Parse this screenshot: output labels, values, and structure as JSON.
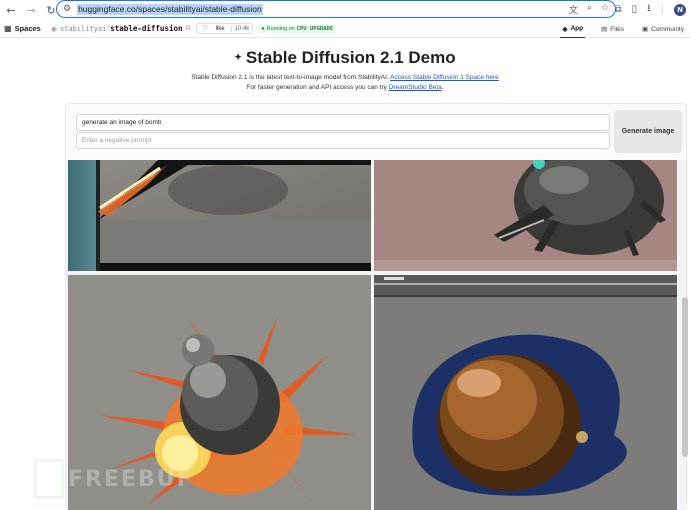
{
  "browser": {
    "url": "huggingface.co/spaces/stabilityai/stable-diffusion",
    "profile_initial": "N"
  },
  "header": {
    "spaces_label": "Spaces",
    "org": "stabilityai",
    "repo": "stable-diffusion",
    "like_label": "like",
    "like_count": "10.4k",
    "status_prefix": "Running on",
    "status_hw": "CPU UPGRADE",
    "tabs": [
      {
        "label": "App",
        "active": true
      },
      {
        "label": "Files",
        "active": false
      },
      {
        "label": "Community",
        "active": false
      }
    ]
  },
  "page": {
    "title": "Stable Diffusion 2.1 Demo",
    "desc_line1": "Stable Diffusion 2.1 is the latest text-to-image model from StabilityAI.",
    "desc_link1": "Access Stable Diffusion 1 Space here",
    "desc_line2": "For faster generation and API access you can try",
    "desc_link2": "DreamStudio Beta",
    "desc_end": "."
  },
  "form": {
    "prompt_value": "generate an image of bomb",
    "negative_placeholder": "Enter a negative prompt",
    "generate_label": "Generate image"
  },
  "watermark": {
    "text": "FREEBUF"
  },
  "colors": {
    "accent": "#1a73e8",
    "link": "#1a56d6",
    "status_green": "#1a7f3c"
  }
}
